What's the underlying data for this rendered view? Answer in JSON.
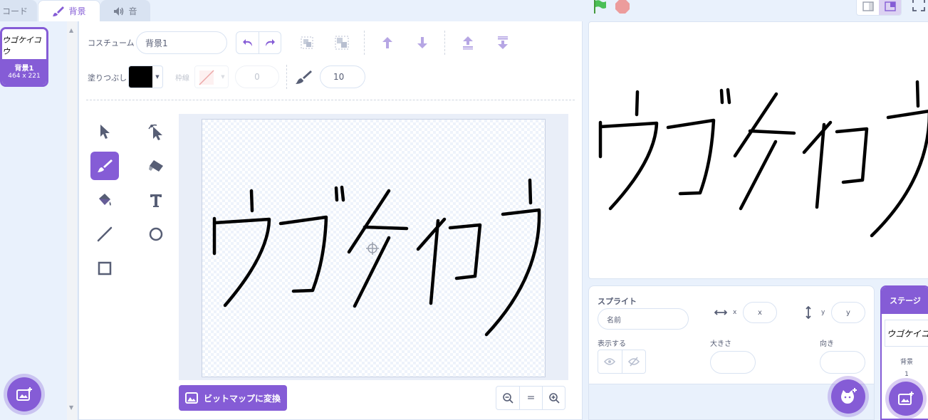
{
  "tabs": {
    "code": "コード",
    "backdrop": "背景",
    "sound": "音"
  },
  "costume_list": {
    "items": [
      {
        "thumb_text": "ウゴケイコウ",
        "name": "背景1",
        "size": "464 x 221"
      }
    ]
  },
  "toolbar": {
    "costume_label": "コスチューム",
    "costume_name": "背景1",
    "fill_label": "塗りつぶし",
    "fill_color": "#000000",
    "outline_label": "枠線",
    "outline_width": "0",
    "brush_size": "10"
  },
  "drawing": {
    "text": "ウゴケイコウ"
  },
  "bottom": {
    "convert_label": "ビットマップに変換",
    "zoom_reset": "="
  },
  "sprite_info": {
    "title": "スプライト",
    "name_placeholder": "名前",
    "x_label": "x",
    "x_placeholder": "x",
    "y_label": "y",
    "y_placeholder": "y",
    "show_label": "表示する",
    "size_label": "大きさ",
    "direction_label": "向き"
  },
  "stage_panel": {
    "header": "ステージ",
    "backdrops_label": "背景",
    "backdrop_count": "1"
  },
  "colors": {
    "accent": "#855cd6",
    "green_flag": "#4cbf56",
    "stop": "#ec9c9c"
  }
}
